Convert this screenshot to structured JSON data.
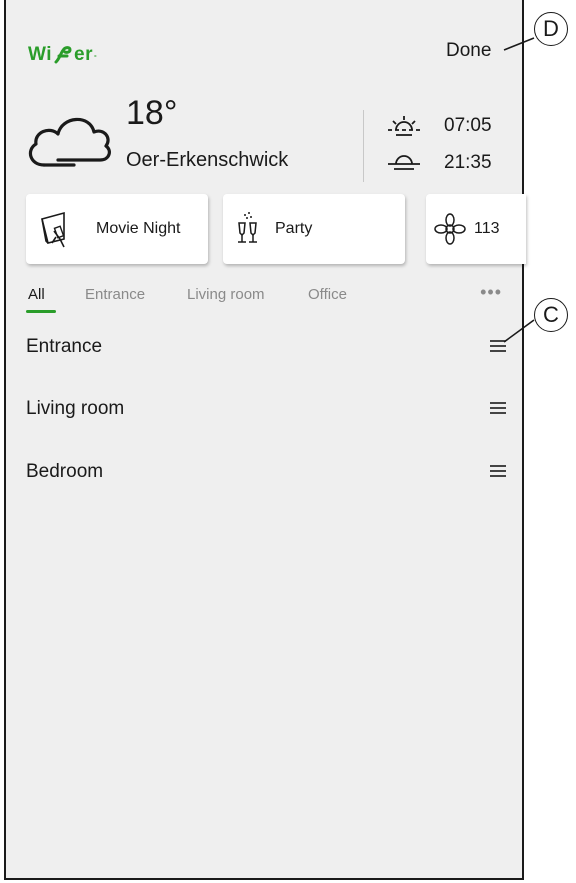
{
  "header": {
    "logo_text": "Wi",
    "logo_text2": "er",
    "done_label": "Done"
  },
  "weather": {
    "temperature": "18°",
    "city": "Oer-Erkenschwick",
    "sunrise": "07:05",
    "sunset": "21:35",
    "icon": "cloud-icon"
  },
  "moments": [
    {
      "label": "Movie Night",
      "icon": "movie-icon"
    },
    {
      "label": "Party",
      "icon": "party-icon"
    },
    {
      "label": "113",
      "icon": "flower-icon"
    }
  ],
  "tabs": [
    "All",
    "Entrance",
    "Living room",
    "Office"
  ],
  "more_label": "•••",
  "rooms": [
    "Entrance",
    "Living room",
    "Bedroom"
  ],
  "callouts": {
    "c": "C",
    "d": "D"
  },
  "colors": {
    "brand": "#2a9d2a",
    "background": "#efefef"
  }
}
